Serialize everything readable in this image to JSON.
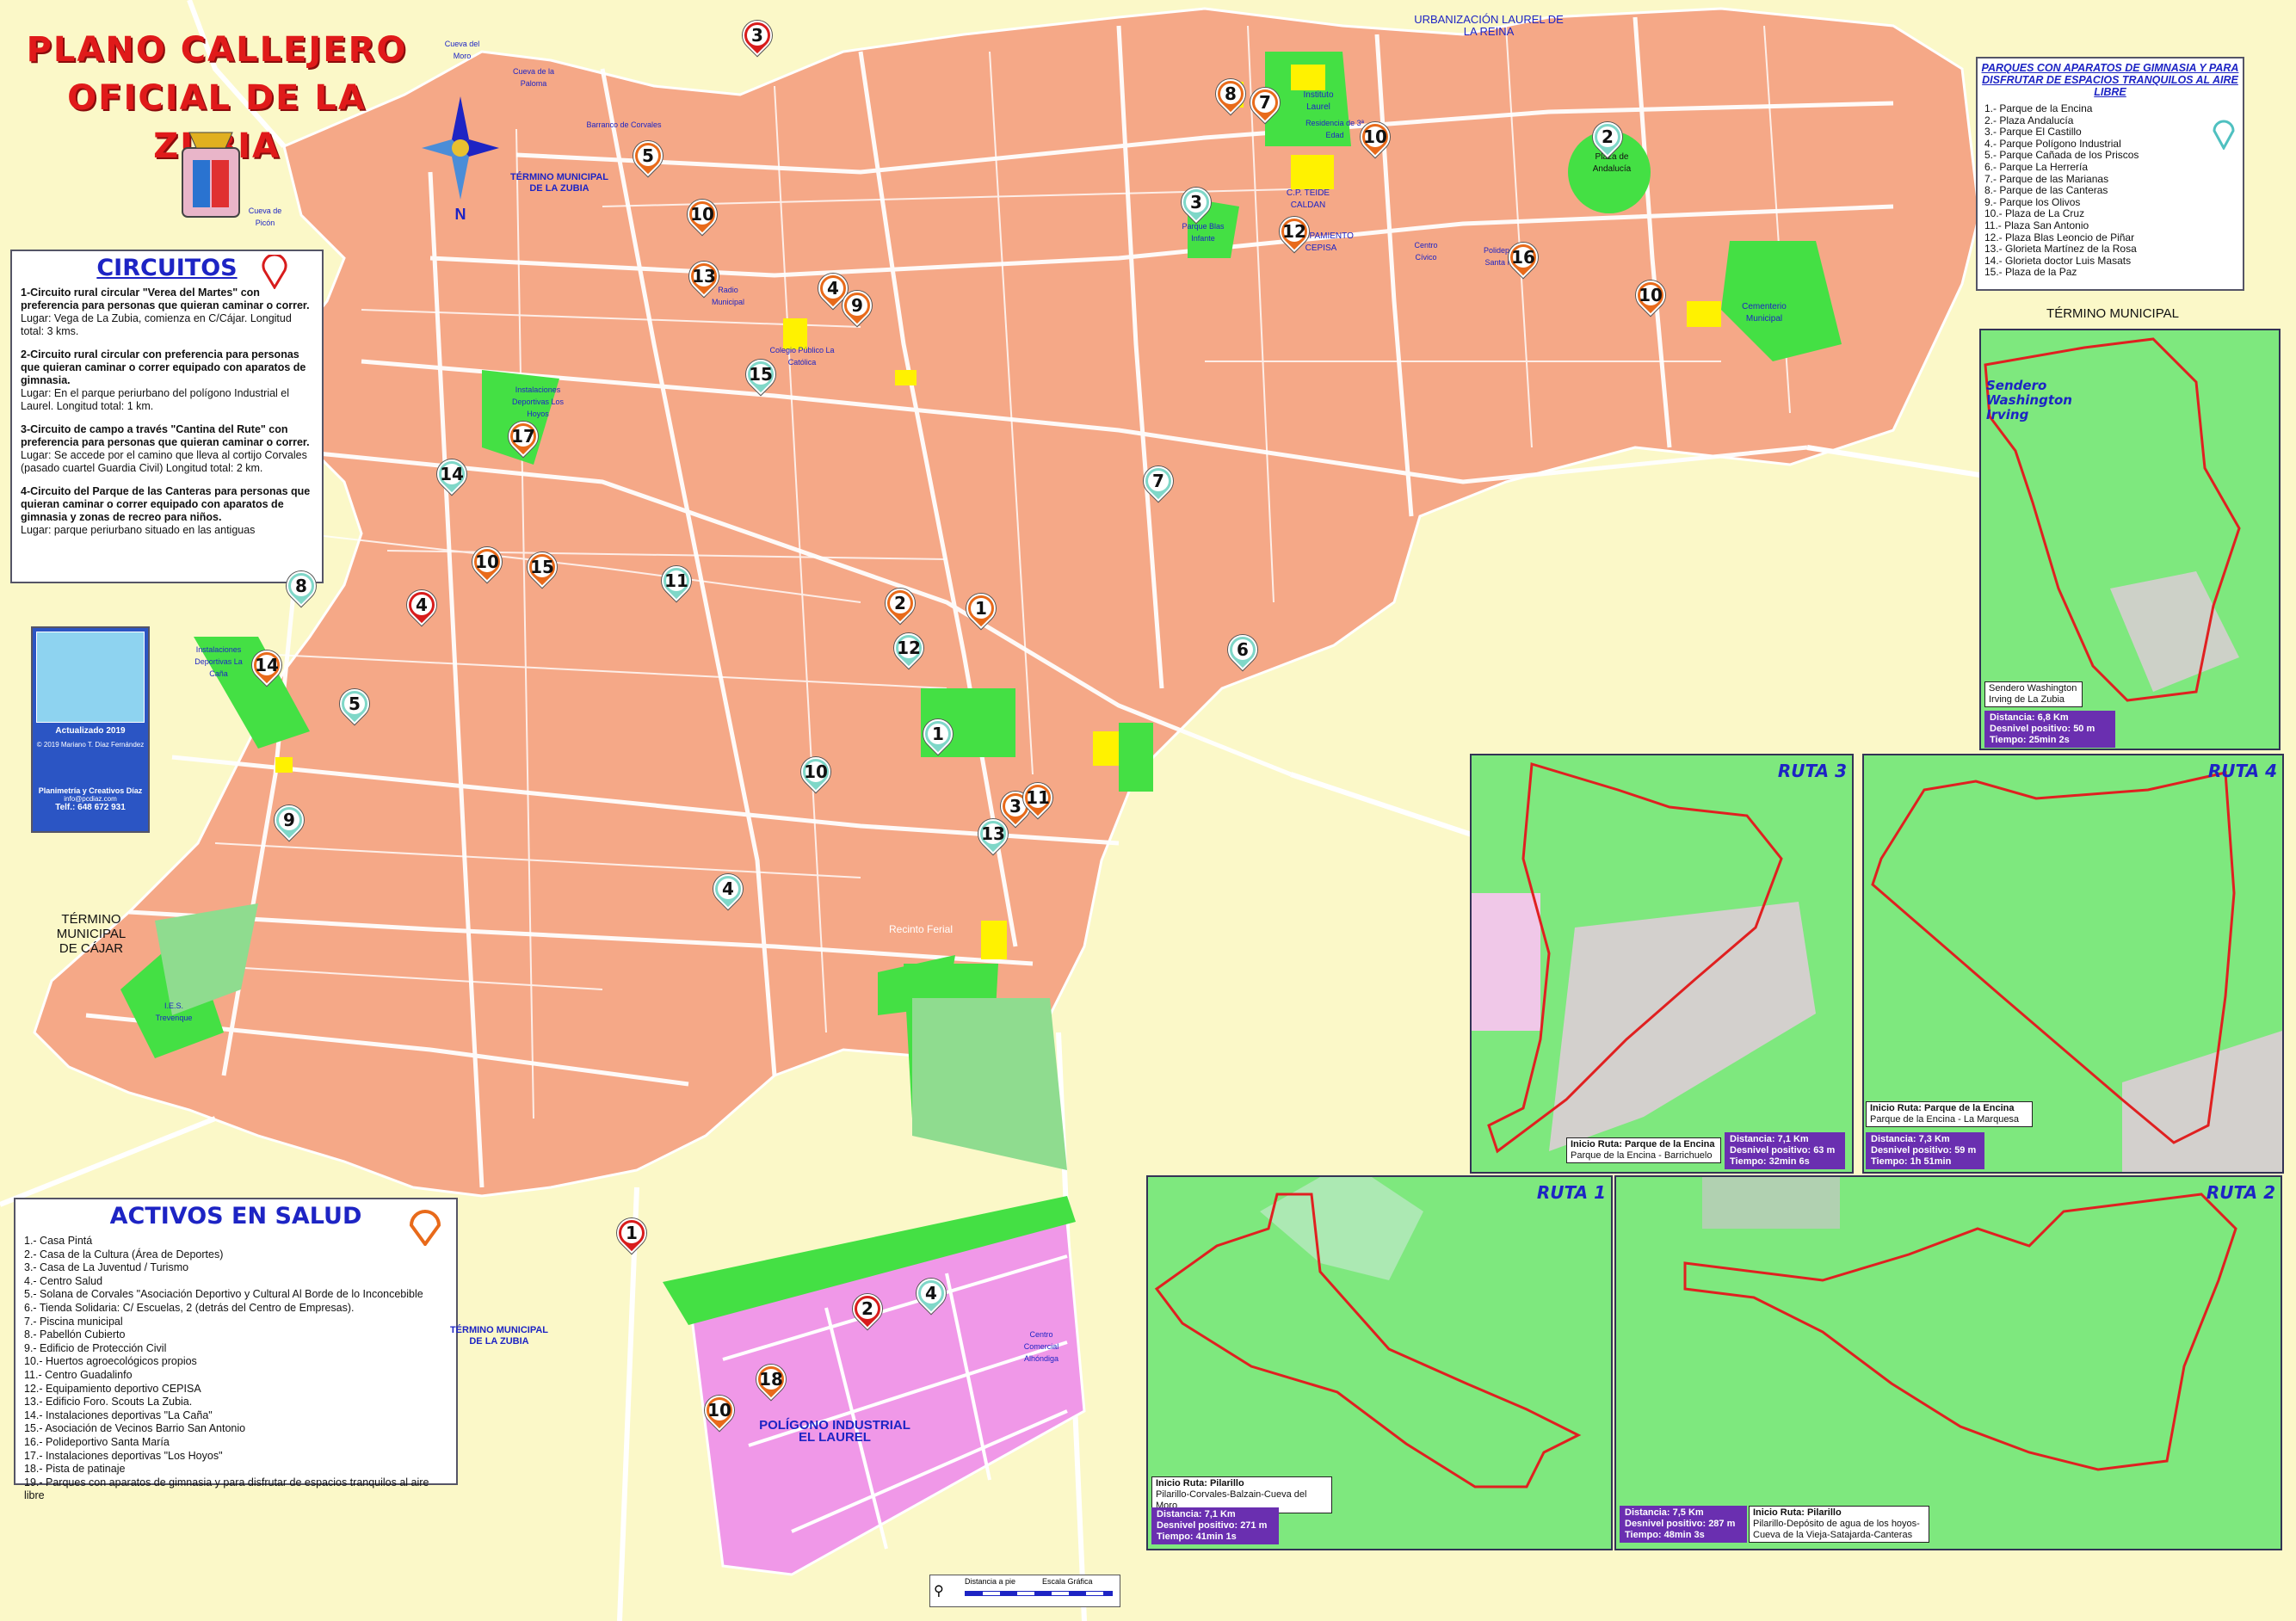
{
  "title": {
    "line1": "PLANO CALLEJERO",
    "line2": "OFICIAL DE LA ZUBIA"
  },
  "compass": "N",
  "circuitos": {
    "title": "CIRCUITOS",
    "items": [
      {
        "heading": "1-Circuito rural circular \"Verea del Martes\" con preferencia para personas que quieran caminar o correr.",
        "detail": "Lugar: Vega de La Zubia, comienza en C/Cájar. Longitud total: 3 kms."
      },
      {
        "heading": "2-Circuito rural circular con preferencia para personas que quieran caminar o correr equipado con aparatos de gimnasia.",
        "detail": "Lugar: En el parque periurbano del polígono Industrial el Laurel. Longitud total: 1 km."
      },
      {
        "heading": "3-Circuito de campo a través \"Cantina del Rute\" con preferencia para personas que quieran caminar o correr.",
        "detail": "Lugar: Se accede por el camino que lleva al cortijo Corvales (pasado cuartel Guardia Civil) Longitud total: 2 km."
      },
      {
        "heading": "4-Circuito del Parque de las Canteras para personas que quieran caminar o correr equipado con aparatos de gimnasia y zonas de recreo para niños.",
        "detail": "Lugar: parque periurbano situado en las antiguas"
      }
    ]
  },
  "activos": {
    "title": "ACTIVOS EN SALUD",
    "items": [
      "1.- Casa Pintá",
      "2.- Casa de la Cultura (Área de Deportes)",
      "3.- Casa de La Juventud / Turismo",
      "4.- Centro Salud",
      "5.- Solana de Corvales \"Asociación Deportivo y Cultural Al Borde de lo Inconcebible",
      "6.- Tienda Solidaria: C/ Escuelas, 2 (detrás del Centro de Empresas).",
      "7.- Piscina municipal",
      "8.- Pabellón Cubierto",
      "9.- Edificio de Protección Civil",
      "10.- Huertos agroecológicos propios",
      "11.- Centro Guadalinfo",
      "12.- Equipamiento deportivo CEPISA",
      "13.- Edificio Foro. Scouts La Zubia.",
      "14.- Instalaciones deportivas \"La Caña\"",
      "15.- Asociación de Vecinos Barrio San Antonio",
      "16.- Polideportivo Santa María",
      "17.- Instalaciones deportivas \"Los Hoyos\"",
      "18.- Pista de patinaje",
      "19.- Parques con aparatos de gimnasia y para disfrutar de espacios tranquilos al aire libre"
    ]
  },
  "parques": {
    "title": "PARQUES CON APARATOS DE GIMNASIA Y PARA DISFRUTAR DE ESPACIOS TRANQUILOS AL AIRE LIBRE",
    "items": [
      "1.- Parque de la Encina",
      "2.- Plaza Andalucía",
      "3.- Parque El Castillo",
      "4.- Parque Polígono Industrial",
      "5.- Parque Cañada de los Priscos",
      "6.- Parque La Herrería",
      "7.- Parque de las Marianas",
      "8.- Parque de las Canteras",
      "9.- Parque los Olivos",
      "10.- Plaza de La Cruz",
      "11.- Plaza San Antonio",
      "12.- Plaza Blas Leoncio de Piñar",
      "13.- Glorieta Martínez de la Rosa",
      "14.- Glorieta doctor Luis Masats",
      "15.- Plaza de la Paz"
    ]
  },
  "municipal_labels": {
    "top_right": "TÉRMINO MUNICIPAL",
    "zubia_top": "TÉRMINO MUNICIPAL DE LA ZUBIA",
    "cajar": "TÉRMINO MUNICIPAL DE CÁJAR",
    "zubia_bottom": "TÉRMINO MUNICIPAL DE LA ZUBIA",
    "laurel": "URBANIZACIÓN LAUREL DE LA REINA"
  },
  "poligono": {
    "name": "POLÍGONO INDUSTRIAL EL LAUREL"
  },
  "routes": {
    "washington": {
      "label": "Sendero Washington Irving",
      "info": "Sendero Washington Irving de La Zubia",
      "distancia": "Distancia: 6,8 Km",
      "desnivel": "Desnivel positivo: 50 m",
      "tiempo": "Tiempo: 25min 2s"
    },
    "ruta3": {
      "label": "RUTA 3",
      "inicio": "Inicio Ruta: Parque de la Encina",
      "recorrido": "Parque de la Encina - Barrichuelo",
      "distancia": "Distancia: 7,1 Km",
      "desnivel": "Desnivel positivo: 63 m",
      "tiempo": "Tiempo: 32min 6s"
    },
    "ruta4": {
      "label": "RUTA 4",
      "inicio": "Inicio Ruta: Parque de la Encina",
      "recorrido": "Parque de la Encina - La Marquesa",
      "distancia": "Distancia: 7,3 Km",
      "desnivel": "Desnivel positivo: 59 m",
      "tiempo": "Tiempo: 1h 51min"
    },
    "ruta1": {
      "label": "RUTA 1",
      "inicio": "Inicio Ruta: Pilarillo",
      "recorrido": "Pilarillo-Corvales-Balzain-Cueva del Moro",
      "distancia": "Distancia: 7,1 Km",
      "desnivel": "Desnivel positivo: 271 m",
      "tiempo": "Tiempo: 41min 1s"
    },
    "ruta2": {
      "label": "RUTA 2",
      "inicio": "Inicio Ruta: Pilarillo",
      "recorrido": "Pilarillo-Depósito de agua de los hoyos-Cueva de la Vieja-Satajarda-Canteras",
      "distancia": "Distancia: 7,5 Km",
      "desnivel": "Desnivel positivo: 287 m",
      "tiempo": "Tiempo: 48min 3s"
    }
  },
  "map_labels": {
    "recinto_ferial": "Recinto Ferial",
    "plaza_andalucia": "Plaza de Andalucía",
    "instituto": "Instituto Laurel",
    "cementerio": "Cementerio Municipal",
    "cueva_moro": "Cueva del Moro",
    "cueva_paloma": "Cueva de la Paloma",
    "cueva_picon": "Cueva de Picón",
    "barranco": "Barranco de Corvales",
    "radio": "Radio Municipal",
    "colegio_catolica": "Colegio Público La Católica",
    "centro_civico": "Centro Cívico",
    "ies": "I.E.S. Trevenque",
    "equipamiento": "EQUIPAMIENTO CEPISA",
    "cp_teide": "C.P. TEIDE CALDAN",
    "instalaciones_hoyos": "Instalaciones Deportivas Los Hoyos",
    "instalaciones_cana": "Instalaciones Deportivas La Caña",
    "parque_blas": "Parque Blas Infante",
    "centro_comercial": "Centro Comercial Alhóndiga",
    "polideportivo": "Polideportivo Santa María",
    "residencia": "Residencia de 3ª Edad"
  },
  "logo": {
    "updated": "Actualizado 2019",
    "copyright": "© 2019 Mariano T. Díaz Fernández",
    "company": "Planimetría y Creativos Díaz",
    "email": "info@pcdiaz.com",
    "phone": "Telf.: 648 672 931"
  },
  "scale": {
    "walk": "Distancia a pie",
    "graphic": "Escala Gráfica"
  },
  "pins": [
    {
      "n": "3",
      "c": "red"
    },
    {
      "n": "5",
      "c": "orange"
    },
    {
      "n": "10",
      "c": "orange"
    },
    {
      "n": "13",
      "c": "orange"
    },
    {
      "n": "4",
      "c": "orange"
    },
    {
      "n": "9",
      "c": "orange"
    },
    {
      "n": "15",
      "c": "teal"
    },
    {
      "n": "17",
      "c": "orange"
    },
    {
      "n": "14",
      "c": "teal"
    },
    {
      "n": "10",
      "c": "orange"
    },
    {
      "n": "15",
      "c": "orange"
    },
    {
      "n": "8",
      "c": "teal"
    },
    {
      "n": "4",
      "c": "red"
    },
    {
      "n": "11",
      "c": "teal"
    },
    {
      "n": "14",
      "c": "orange"
    },
    {
      "n": "5",
      "c": "teal"
    },
    {
      "n": "9",
      "c": "teal"
    },
    {
      "n": "8",
      "c": "orange"
    },
    {
      "n": "7",
      "c": "orange"
    },
    {
      "n": "3",
      "c": "teal"
    },
    {
      "n": "12",
      "c": "orange"
    },
    {
      "n": "2",
      "c": "teal"
    },
    {
      "n": "10",
      "c": "orange"
    },
    {
      "n": "16",
      "c": "orange"
    },
    {
      "n": "10",
      "c": "orange"
    },
    {
      "n": "7",
      "c": "teal"
    },
    {
      "n": "2",
      "c": "orange"
    },
    {
      "n": "1",
      "c": "orange"
    },
    {
      "n": "12",
      "c": "teal"
    },
    {
      "n": "1",
      "c": "teal"
    },
    {
      "n": "6",
      "c": "teal"
    },
    {
      "n": "10",
      "c": "teal"
    },
    {
      "n": "3",
      "c": "orange"
    },
    {
      "n": "11",
      "c": "orange"
    },
    {
      "n": "13",
      "c": "teal"
    },
    {
      "n": "4",
      "c": "teal"
    },
    {
      "n": "1",
      "c": "red"
    },
    {
      "n": "2",
      "c": "red"
    },
    {
      "n": "4",
      "c": "teal"
    },
    {
      "n": "18",
      "c": "orange"
    },
    {
      "n": "10",
      "c": "orange"
    }
  ]
}
